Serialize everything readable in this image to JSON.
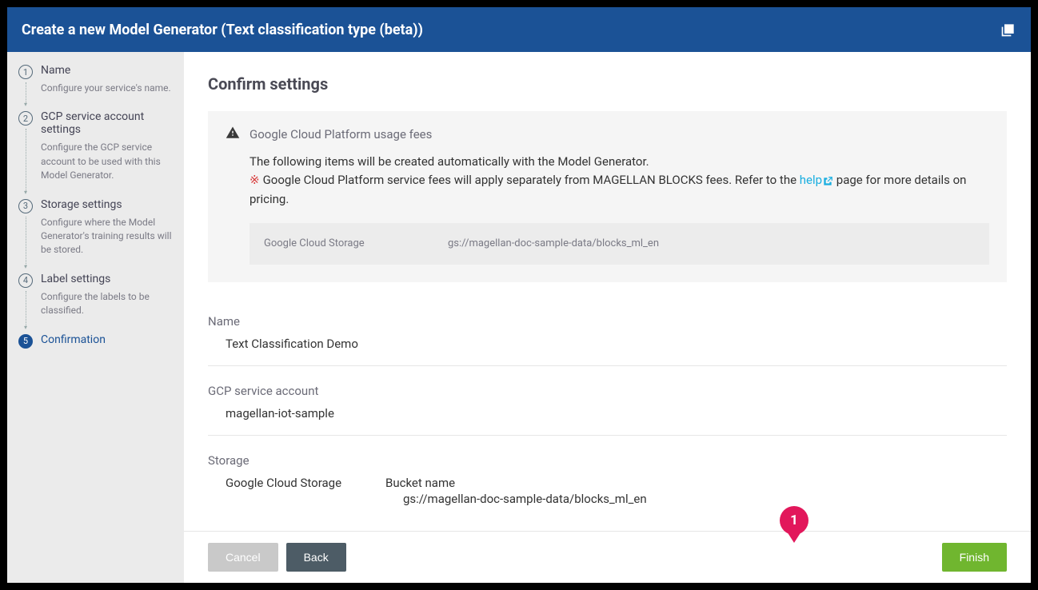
{
  "header": {
    "title": "Create a new Model Generator (Text classification type (beta))"
  },
  "sidebar": {
    "steps": [
      {
        "num": "1",
        "title": "Name",
        "desc": "Configure your service's name."
      },
      {
        "num": "2",
        "title": "GCP service account settings",
        "desc": "Configure the GCP service account to be used with this Model Generator."
      },
      {
        "num": "3",
        "title": "Storage settings",
        "desc": "Configure where the Model Generator's training results will be stored."
      },
      {
        "num": "4",
        "title": "Label settings",
        "desc": "Configure the labels to be classified."
      },
      {
        "num": "5",
        "title": "Confirmation",
        "desc": ""
      }
    ]
  },
  "main": {
    "title": "Confirm settings",
    "warning": {
      "heading": "Google Cloud Platform usage fees",
      "line1": "The following items will be created automatically with the Model Generator.",
      "asterisk": "※",
      "line2a": "Google Cloud Platform service fees will apply separately from MAGELLAN BLOCKS fees. Refer to the ",
      "help": "help",
      "line2b": " page for more details on pricing.",
      "table": {
        "label": "Google Cloud Storage",
        "value": "gs://magellan-doc-sample-data/blocks_ml_en"
      }
    },
    "sections": {
      "name": {
        "label": "Name",
        "value": "Text Classification Demo"
      },
      "gcp": {
        "label": "GCP service account",
        "value": "magellan-iot-sample"
      },
      "storage": {
        "label": "Storage",
        "type": "Google Cloud Storage",
        "bucket_label": "Bucket name",
        "bucket_value": "gs://magellan-doc-sample-data/blocks_ml_en"
      }
    }
  },
  "footer": {
    "cancel": "Cancel",
    "back": "Back",
    "finish": "Finish"
  },
  "annotation": {
    "pin1": "1"
  }
}
